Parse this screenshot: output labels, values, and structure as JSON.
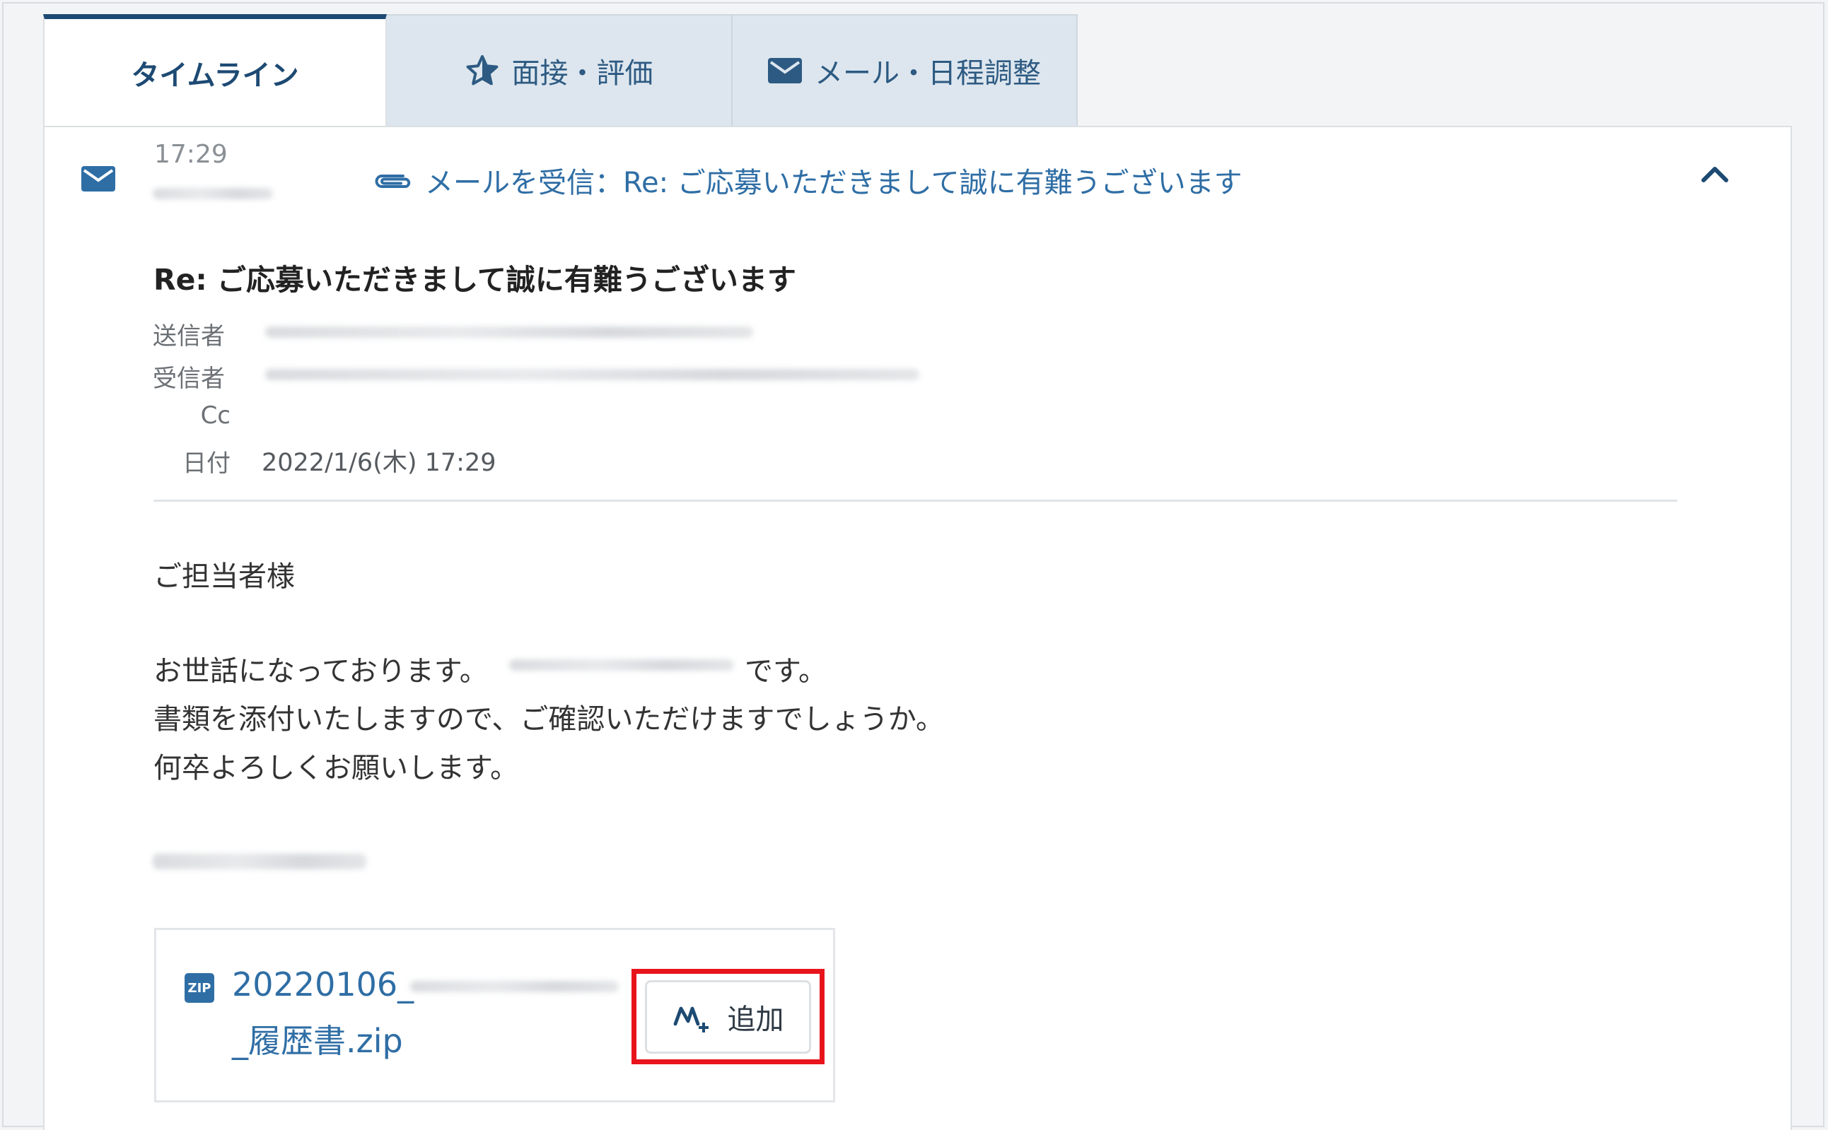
{
  "tabs": [
    {
      "label": "タイムライン",
      "icon": null,
      "active": true
    },
    {
      "label": "面接・評価",
      "icon": "star-icon",
      "active": false
    },
    {
      "label": "メール・日程調整",
      "icon": "mail-icon",
      "active": false
    }
  ],
  "entry": {
    "time": "17:29",
    "summary": "メールを受信：Re: ご応募いただきまして誠に有難うございます",
    "icon": "mail-icon"
  },
  "email": {
    "subject": "Re: ご応募いただきまして誠に有難うございます",
    "labels": {
      "from": "送信者",
      "to": "受信者",
      "cc": "Cc",
      "date": "日付"
    },
    "date_value": "2022/1/6(木) 17:29",
    "greeting": "ご担当者様",
    "line1_prefix": "お世話になっております。",
    "line1_suffix": "です。",
    "line2": "書類を添付いたしますので、ご確認いただけますでしょうか。",
    "line3": "何卒よろしくお願いします。"
  },
  "attachment": {
    "icon_text": "ZIP",
    "name_line1": "20220106_",
    "name_line2": "_履歴書.zip",
    "add_label": "追加"
  },
  "colors": {
    "accent": "#2f6ea5",
    "tab_active": "#1d4a73",
    "highlight": "#e8141c"
  }
}
